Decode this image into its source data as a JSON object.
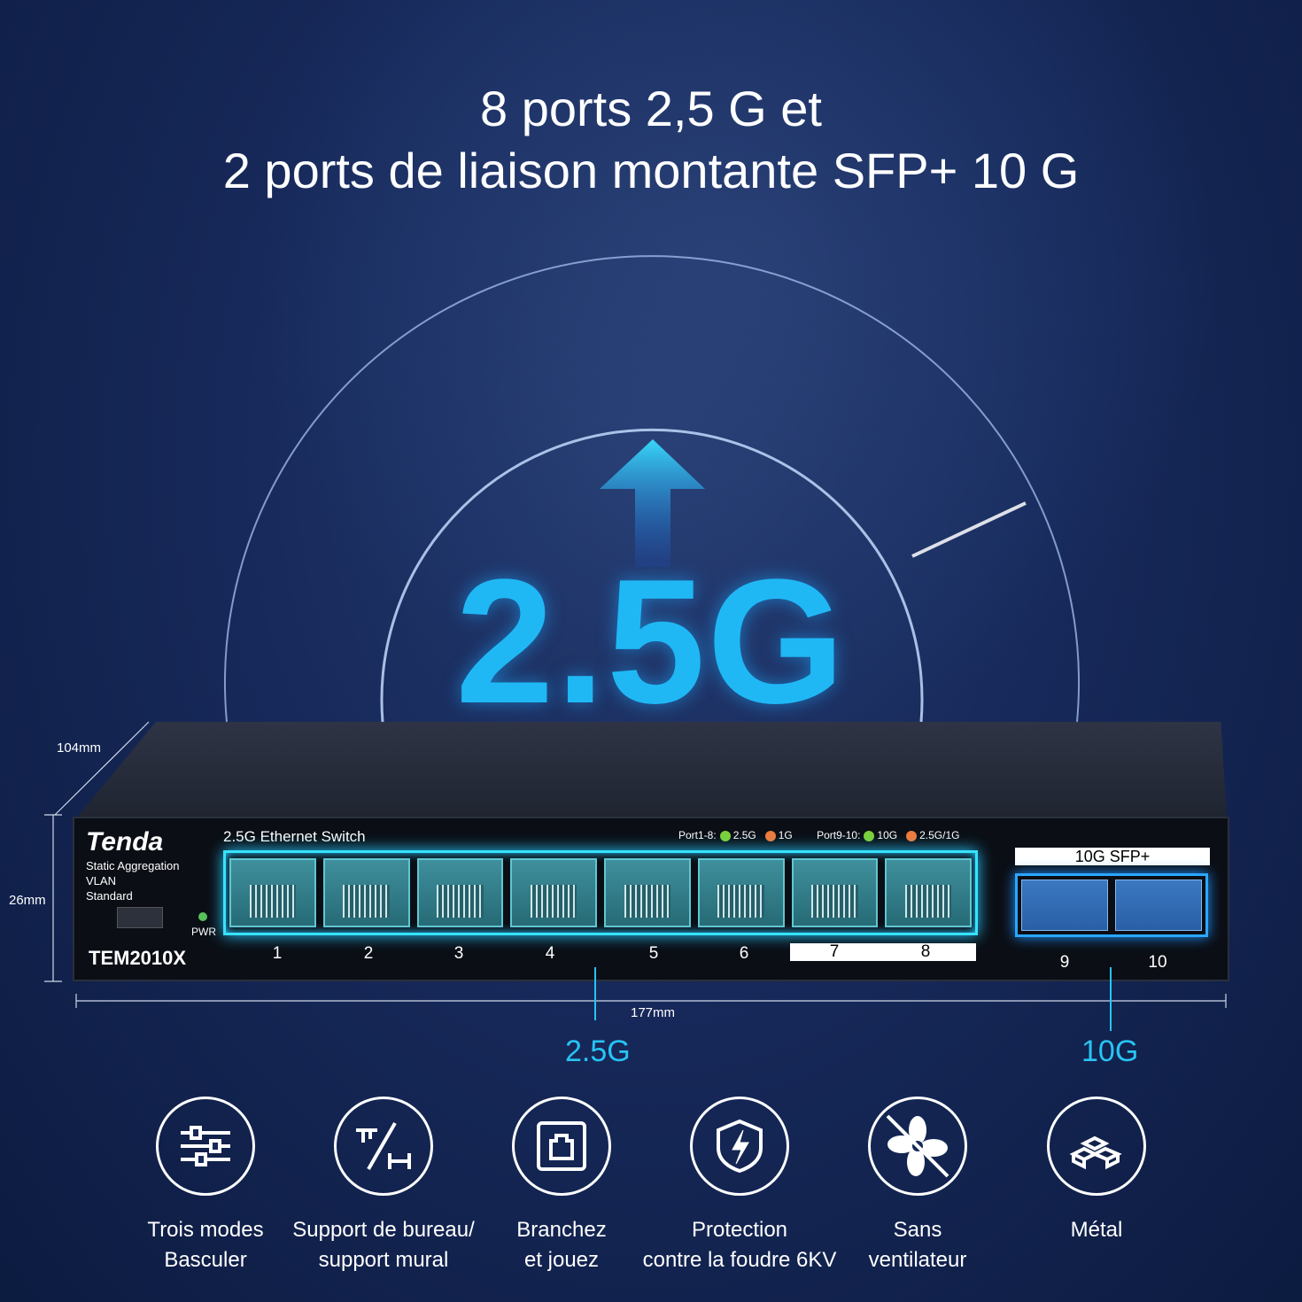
{
  "headline": {
    "line1": "8 ports 2,5 G et",
    "line2": "2 ports de liaison montante SFP+ 10 G"
  },
  "hero_text": "2.5G",
  "dimensions": {
    "depth": "104mm",
    "height": "26mm",
    "width": "177mm"
  },
  "switch": {
    "brand": "Tenda",
    "title": "2.5G Ethernet Switch",
    "model": "TEM2010X",
    "modes": [
      "Static Aggregation",
      "VLAN",
      "Standard"
    ],
    "pwr": "PWR",
    "legend": {
      "port1_8": "Port1-8:",
      "p18_a": "2.5G",
      "p18_b": "1G",
      "port9_10": "Port9-10:",
      "p910_a": "10G",
      "p910_b": "2.5G/1G"
    },
    "sfp_label": "10G SFP+",
    "ports": [
      "1",
      "2",
      "3",
      "4",
      "5",
      "6",
      "7",
      "8"
    ],
    "sfp_ports": [
      "9",
      "10"
    ]
  },
  "callouts": {
    "left": "2.5G",
    "right": "10G"
  },
  "features": [
    {
      "icon": "sliders-icon",
      "l1": "Trois modes",
      "l2": "Basculer"
    },
    {
      "icon": "mount-icon",
      "l1": "Support de bureau/",
      "l2": "support mural"
    },
    {
      "icon": "plug-icon",
      "l1": "Branchez",
      "l2": "et jouez"
    },
    {
      "icon": "shield-lightning-icon",
      "l1": "Protection",
      "l2": "contre la foudre 6KV"
    },
    {
      "icon": "no-fan-icon",
      "l1": "Sans",
      "l2": "ventilateur"
    },
    {
      "icon": "metal-bars-icon",
      "l1": "Métal",
      "l2": ""
    }
  ],
  "colors": {
    "accent": "#27c4f5",
    "green_led": "#7cd13a",
    "orange_led": "#f07a3a"
  }
}
